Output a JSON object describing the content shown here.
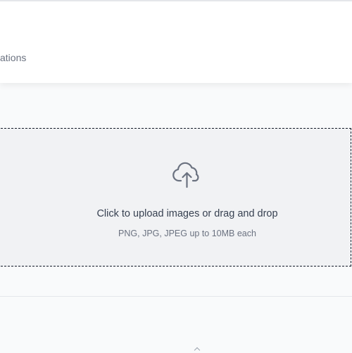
{
  "header": {
    "partial_text": "ations"
  },
  "upload": {
    "icon": "cloud-upload-icon",
    "title": "Click to upload images or drag and drop",
    "subtitle": "PNG, JPG, JPEG up to 10MB each"
  },
  "colors": {
    "background": "#f9fafb",
    "card": "#ffffff",
    "dropzone": "#f1f2f4",
    "dashed_border": "#111827",
    "title_text": "#374151",
    "muted_text": "#6b7280",
    "icon": "#6b7280"
  }
}
